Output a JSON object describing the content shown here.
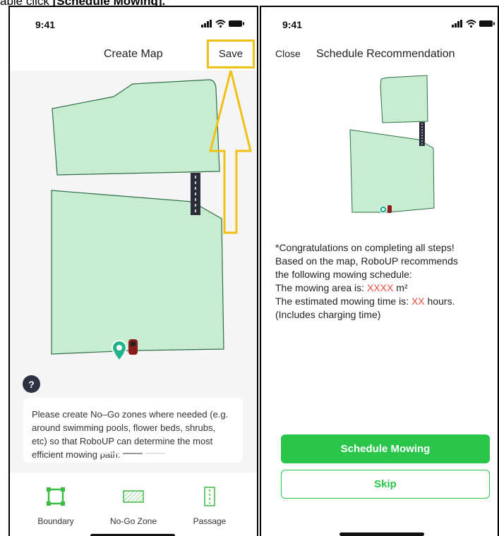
{
  "caption": {
    "prefix": "able click ",
    "bold": "[Schedule Mowing]."
  },
  "left": {
    "time": "9:41",
    "title": "Create Map",
    "save_label": "Save",
    "help_label": "?",
    "info_text": "Please create No–Go zones where needed (e.g. around swimming pools, flower beds, shrubs, etc) so that  RoboUP can determine the most efficient mowing path.",
    "tools": [
      {
        "label": "Boundary",
        "icon": "boundary-icon"
      },
      {
        "label": "No-Go Zone",
        "icon": "no-go-zone-icon"
      },
      {
        "label": "Passage",
        "icon": "passage-icon"
      }
    ]
  },
  "right": {
    "time": "9:41",
    "close_label": "Close",
    "title": "Schedule Recommendation",
    "lines": [
      "*Congratulations on completing all steps!",
      "Based on the map, RoboUP recommends",
      "the following mowing schedule:"
    ],
    "area_prefix": "The mowing area is: ",
    "area_value": "XXXX",
    "area_unit": " m²",
    "time_prefix": "The estimated mowing time is: ",
    "time_value": "XX",
    "time_suffix": " hours.",
    "charging_note": "(Includes charging time)",
    "primary_button": "Schedule Mowing",
    "secondary_button": "Skip"
  },
  "colors": {
    "lawn_fill": "#c8ecd0",
    "lawn_stroke": "#2f6e47",
    "accent_green": "#29c64a",
    "highlight_yellow": "#f2c014",
    "placeholder_red": "#e74c3c"
  }
}
